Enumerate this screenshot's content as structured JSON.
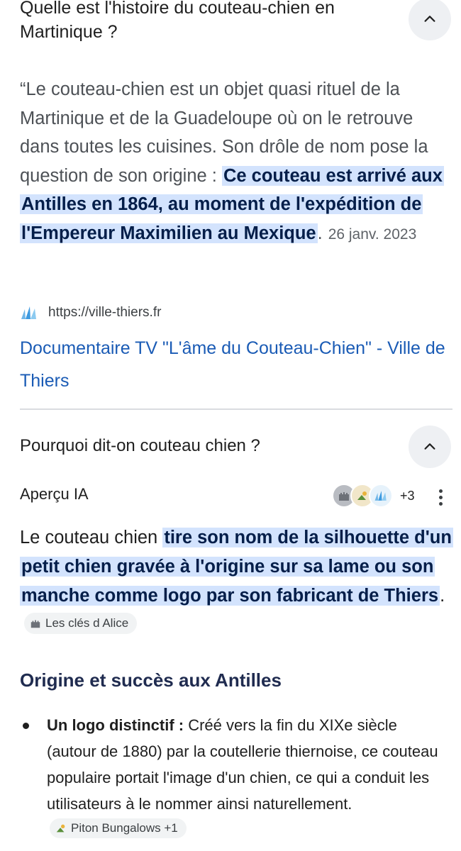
{
  "faq1": {
    "question": "Quelle est l'histoire du couteau-chien en Martinique ?",
    "snippet_before": "“Le couteau-chien est un objet quasi rituel de la Martinique et de la Guadeloupe où on le retrouve dans toutes les cuisines. Son drôle de nom pose la question de son origine : ",
    "snippet_highlight": "Ce couteau est arrivé aux Antilles en 1864, au moment de l'expédition de l'Empereur Maximilien au Mexique",
    "snippet_after": ".",
    "date": "26 janv. 2023",
    "source_url": "https://ville-thiers.fr",
    "source_icon": "ville-thiers-logo-icon",
    "link_title": "Documentaire TV \"L'âme du Couteau-Chien\" - Ville de Thiers"
  },
  "faq2": {
    "question": "Pourquoi dit-on couteau chien ?",
    "ai_label": "Aperçu IA",
    "sources_more": "+3",
    "ai_before": "Le couteau chien ",
    "ai_highlight": "tire son nom de la silhouette d'un petit chien gravée à l'origine sur sa lame ou son manche comme logo par son fabricant de Thiers",
    "ai_after": ".",
    "ai_chip": "Les clés d Alice",
    "section_heading": "Origine et succès aux Antilles",
    "bullets": [
      {
        "title": "Un logo distinctif :",
        "text": " Créé vers la fin du XIXe siècle (autour de 1880) par la coutellerie thiernoise, ce couteau populaire portait l'image d'un chien, ce qui a conduit les utilisateurs à le nommer ainsi naturellement.",
        "chip": "Piton Bungalows +1"
      }
    ]
  },
  "colors": {
    "highlight_bg": "#d3e3fd",
    "highlight_text": "#041e49",
    "link": "#1a5bb5",
    "chevron_bg": "#eef0f3"
  }
}
